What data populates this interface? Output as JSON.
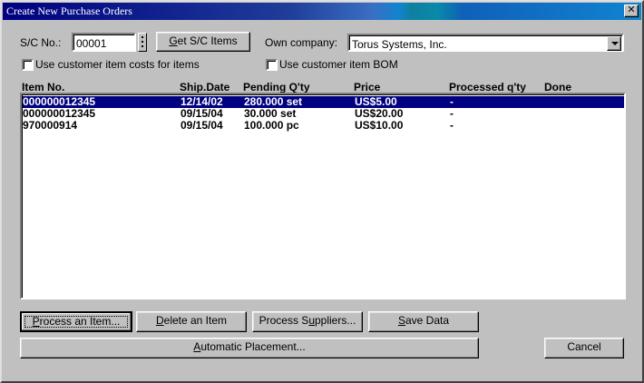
{
  "window": {
    "title": "Create New Purchase Orders",
    "close_label": "✕"
  },
  "form": {
    "sc_no_label": "S/C No.:",
    "sc_no_value": "00001",
    "get_sc_items_prefix": "G",
    "get_sc_items_rest": "et S/C Items",
    "own_company_label": "Own company:",
    "own_company_value": "Torus Systems, Inc.",
    "use_customer_costs_label": "Use customer item costs for items",
    "use_customer_bom_label": "Use customer item BOM"
  },
  "table": {
    "columns": [
      "Item No.",
      "Ship.Date",
      "Pending Q'ty",
      "Price",
      "Processed q'ty",
      "Done"
    ],
    "rows": [
      {
        "item_no": "000000012345",
        "ship_date": "12/14/02",
        "pending_qty": "280.000 set",
        "price": "US$5.00",
        "processed_qty": "-",
        "done": "",
        "selected": true
      },
      {
        "item_no": "000000012345",
        "ship_date": "09/15/04",
        "pending_qty": "30.000 set",
        "price": "US$20.00",
        "processed_qty": "-",
        "done": "",
        "selected": false
      },
      {
        "item_no": "970000914",
        "ship_date": "09/15/04",
        "pending_qty": "100.000 pc",
        "price": "US$10.00",
        "processed_qty": "-",
        "done": "",
        "selected": false
      }
    ]
  },
  "buttons": {
    "process_item_prefix": "P",
    "process_item_rest": "rocess an Item...",
    "delete_item_prefix": "D",
    "delete_item_rest": "elete an Item",
    "process_suppliers_prefix": "Process S",
    "process_suppliers_u": "u",
    "process_suppliers_rest": "ppliers...",
    "save_data_prefix": "S",
    "save_data_rest": "ave Data",
    "auto_placement_prefix": "A",
    "auto_placement_rest": "utomatic Placement...",
    "cancel": "Cancel"
  }
}
